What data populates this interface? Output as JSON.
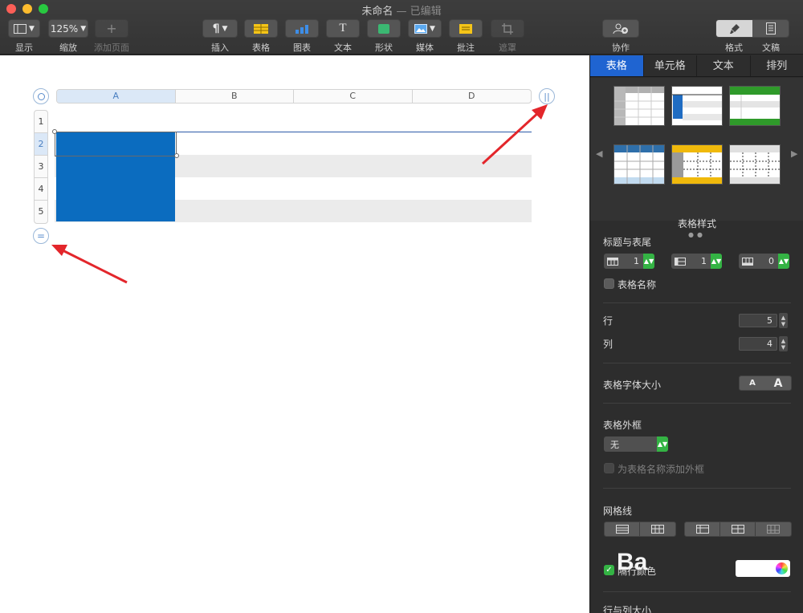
{
  "window": {
    "title": "未命名",
    "subtitle": "— 已编辑"
  },
  "toolbar": {
    "view_label": "显示",
    "zoom_value": "125%",
    "zoom_label": "缩放",
    "add_page_label": "添加页面",
    "insert_label": "插入",
    "table_label": "表格",
    "chart_label": "图表",
    "text_label": "文本",
    "shape_label": "形状",
    "media_label": "媒体",
    "comment_label": "批注",
    "mask_label": "遮罩",
    "collaborate_label": "协作",
    "format_label": "格式",
    "document_label": "文稿"
  },
  "table": {
    "columns": [
      "A",
      "B",
      "C",
      "D"
    ],
    "rows": [
      "1",
      "2",
      "3",
      "4",
      "5"
    ],
    "selected_column": "A",
    "selected_row": "2"
  },
  "inspector": {
    "tabs": [
      "表格",
      "单元格",
      "文本",
      "排列"
    ],
    "active_tab": "表格",
    "styles_label": "表格样式",
    "headers_footers_label": "标题与表尾",
    "header_rows": "1",
    "header_columns": "1",
    "footer_rows": "0",
    "table_name_label": "表格名称",
    "rows_label": "行",
    "rows_value": "5",
    "columns_label": "列",
    "columns_value": "4",
    "font_size_label": "表格字体大小",
    "font_small": "A",
    "font_large": "A",
    "outline_label": "表格外框",
    "outline_value": "无",
    "outline_name_label": "为表格名称添加外框",
    "gridlines_label": "网格线",
    "alternate_rows_label": "隔行颜色",
    "row_col_size_label": "行与列大小"
  },
  "colors": {
    "selection_blue": "#0b6cbf",
    "active_tab_blue": "#1f64d1",
    "stepper_green": "#34b344",
    "arrow_red": "#e3262b"
  }
}
